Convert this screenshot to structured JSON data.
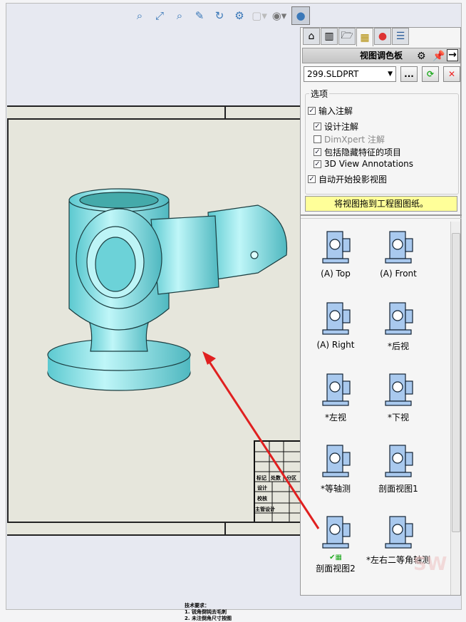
{
  "toolbar": {
    "icons": [
      "zoom-to-fit-icon",
      "zoom-to-area-icon",
      "zoom-in-out-icon",
      "previous-view-icon",
      "rotate-icon",
      "section-view-icon",
      "view-orientation-icon",
      "hide-show-icon",
      "appearance-icon"
    ]
  },
  "panel": {
    "tabs": [
      "home-icon",
      "design-library-icon",
      "file-explorer-icon",
      "view-palette-icon",
      "appearances-icon",
      "custom-properties-icon"
    ],
    "title": "视图调色板",
    "file": "299.SLDPRT",
    "browse_label": "...",
    "options_legend": "选项",
    "options": [
      {
        "label": "输入注解",
        "checked": true,
        "enabled": true
      },
      {
        "label": "设计注解",
        "checked": true,
        "enabled": true
      },
      {
        "label": "DimXpert 注解",
        "checked": false,
        "enabled": false
      },
      {
        "label": "包括隐藏特征的项目",
        "checked": true,
        "enabled": true
      },
      {
        "label": "3D View Annotations",
        "checked": true,
        "enabled": true
      },
      {
        "label": "自动开始投影视图",
        "checked": true,
        "enabled": true
      }
    ],
    "hint": "将视图拖到工程图图纸。",
    "views": [
      "(A) Top",
      "(A) Front",
      "(A) Right",
      "*后视",
      "*左视",
      "*下视",
      "*等轴测",
      "剖面视图1",
      "剖面视图2",
      "*左右二等角轴测"
    ]
  },
  "drawing": {
    "title_block": [
      "标记",
      "处数",
      "分区",
      "设计",
      "校核",
      "主管设计"
    ],
    "notes": [
      "技术要求：",
      "1. 锐角倒钝去毛刺",
      "2. 未注倒角尺寸按图"
    ],
    "part_color": "#7fe0e6",
    "arrow_color": "#e02020"
  },
  "watermark": "SW"
}
